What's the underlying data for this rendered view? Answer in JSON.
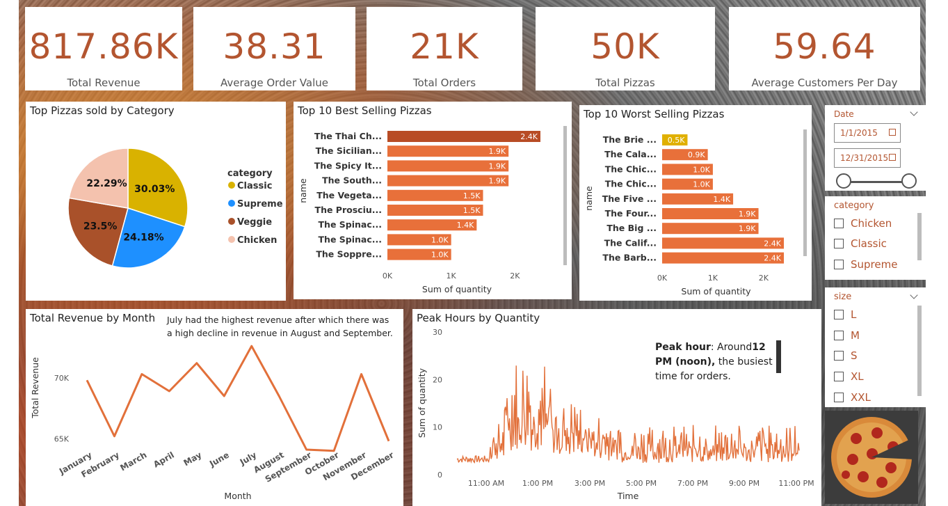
{
  "kpis": [
    {
      "value": "817.86K",
      "label": "Total Revenue"
    },
    {
      "value": "38.31",
      "label": "Average Order Value"
    },
    {
      "value": "21K",
      "label": "Total Orders"
    },
    {
      "value": "50K",
      "label": "Total Pizzas"
    },
    {
      "value": "59.64",
      "label": "Average Customers Per Day"
    }
  ],
  "colors": {
    "accent": "#b35530",
    "bar": "#e8703a",
    "bar_top": "#b84c25",
    "highlight": "#e0b000",
    "classic": "#d9b200",
    "supreme": "#1e90ff",
    "veggie": "#a9512a",
    "chicken": "#f4c2ae"
  },
  "chart_data": [
    {
      "type": "pie",
      "title": "Top Pizzas sold by Category",
      "legend_title": "category",
      "legend_position": "right",
      "slices": [
        {
          "name": "Classic",
          "value": 30.03,
          "label": "30.03%"
        },
        {
          "name": "Supreme",
          "value": 24.18,
          "label": "24.18%"
        },
        {
          "name": "Veggie",
          "value": 23.5,
          "label": "23.5%"
        },
        {
          "name": "Chicken",
          "value": 22.29,
          "label": "22.29%"
        }
      ]
    },
    {
      "type": "bar",
      "title": "Top 10 Best Selling Pizzas",
      "xlabel": "Sum of quantity",
      "ylabel": "name",
      "xlim": [
        0,
        2400
      ],
      "xticks": [
        "0K",
        "1K",
        "2K"
      ],
      "categories": [
        "The Thai Ch...",
        "The Sicilian...",
        "The Spicy It...",
        "The South...",
        "The Vegeta...",
        "The Prosciu...",
        "The Spinac...",
        "The Spinac...",
        "The Soppre..."
      ],
      "values": [
        2400,
        1900,
        1900,
        1900,
        1500,
        1500,
        1400,
        1000,
        1000
      ],
      "labels": [
        "2.4K",
        "1.9K",
        "1.9K",
        "1.9K",
        "1.5K",
        "1.5K",
        "1.4K",
        "1.0K",
        "1.0K"
      ]
    },
    {
      "type": "bar",
      "title": "Top 10 Worst Selling Pizzas",
      "xlabel": "Sum of quantity",
      "ylabel": "name",
      "xlim": [
        0,
        2400
      ],
      "xticks": [
        "0K",
        "1K",
        "2K"
      ],
      "categories": [
        "The Brie ...",
        "The Cala...",
        "The Chic...",
        "The Chic...",
        "The Five ...",
        "The Four...",
        "The Big ...",
        "The Calif...",
        "The Barb..."
      ],
      "values": [
        500,
        900,
        1000,
        1000,
        1400,
        1900,
        1900,
        2400,
        2400
      ],
      "labels": [
        "0.5K",
        "0.9K",
        "1.0K",
        "1.0K",
        "1.4K",
        "1.9K",
        "1.9K",
        "2.4K",
        "2.4K"
      ]
    },
    {
      "type": "line",
      "title": "Total Revenue by Month",
      "xlabel": "Month",
      "ylabel": "Total Revenue",
      "yticks": [
        "70K",
        "65K"
      ],
      "ylim": [
        64500,
        72500
      ],
      "annotation": "July had the highest revenue after which there was a high decline in revenue in August and September.",
      "categories": [
        "January",
        "February",
        "March",
        "April",
        "May",
        "June",
        "July",
        "August",
        "September",
        "October",
        "November",
        "December"
      ],
      "values": [
        69800,
        65200,
        70300,
        68900,
        71200,
        68500,
        72600,
        68500,
        64100,
        64000,
        70300,
        64800
      ]
    },
    {
      "type": "line",
      "title": "Peak Hours by Quantity",
      "xlabel": "Time",
      "ylabel": "Sum of quantity",
      "ylim": [
        0,
        30
      ],
      "yticks": [
        "30",
        "20",
        "10",
        "0"
      ],
      "xticks": [
        "11:00 AM",
        "1:00 PM",
        "3:00 PM",
        "5:00 PM",
        "7:00 PM",
        "9:00 PM",
        "11:00 PM"
      ],
      "annotation_bold1": "Peak hour",
      "annotation_text1": ": Around",
      "annotation_bold2": "12 PM (noon),",
      "annotation_text2": " the busiest time for orders."
    }
  ],
  "slicers": {
    "date": {
      "title": "Date",
      "from": "1/1/2015",
      "to": "12/31/2015"
    },
    "category": {
      "title": "category",
      "items": [
        "Chicken",
        "Classic",
        "Supreme"
      ]
    },
    "size": {
      "title": "size",
      "items": [
        "L",
        "M",
        "S",
        "XL",
        "XXL"
      ]
    }
  }
}
